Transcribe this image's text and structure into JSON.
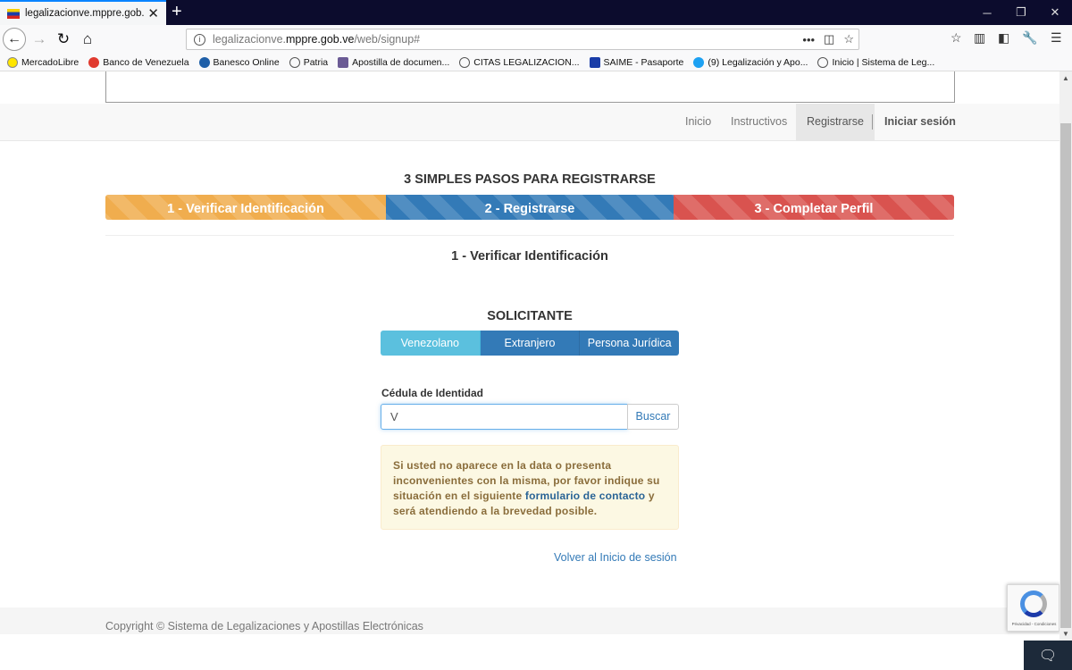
{
  "browser": {
    "tab_title": "legalizacionve.mppre.gob.ve/w",
    "new_tab_glyph": "+",
    "url_plain": "legalizacionve.",
    "url_domain": "mppre.gob.ve",
    "url_path": "/web/signup#",
    "bookmarks": [
      {
        "label": "MercadoLibre",
        "color": "#ffe600"
      },
      {
        "label": "Banco de Venezuela",
        "color": "#e03a2f"
      },
      {
        "label": "Banesco Online",
        "color": "#1f5fa8"
      },
      {
        "label": "Patria",
        "color": "#7a7a7a"
      },
      {
        "label": "Apostilla de documen...",
        "color": "#6b5b95"
      },
      {
        "label": "CITAS LEGALIZACION...",
        "color": "#7a7a7a"
      },
      {
        "label": "SAIME - Pasaporte",
        "color": "#1a3da8"
      },
      {
        "label": "(9) Legalización y Apo...",
        "color": "#1da1f2"
      },
      {
        "label": "Inicio | Sistema de Leg...",
        "color": "#7a7a7a"
      }
    ]
  },
  "nav": {
    "items": [
      {
        "label": "Inicio"
      },
      {
        "label": "Instructivos"
      },
      {
        "label": "Registrarse"
      },
      {
        "label": "Iniciar sesión"
      }
    ]
  },
  "steps": {
    "title": "3 SIMPLES PASOS PARA REGISTRARSE",
    "bars": [
      {
        "label": "1 - Verificar Identificación",
        "color": "#f0ad4e"
      },
      {
        "label": "2 - Registrarse",
        "color": "#337ab7"
      },
      {
        "label": "3 - Completar Perfil",
        "color": "#d9534f"
      }
    ],
    "current_heading": "1 - Verificar Identificación"
  },
  "form": {
    "solicitante_title": "SOLICITANTE",
    "types": [
      {
        "label": "Venezolano",
        "active": true
      },
      {
        "label": "Extranjero",
        "active": false
      },
      {
        "label": "Persona Jurídica",
        "active": false
      }
    ],
    "cedula_label": "Cédula de Identidad",
    "cedula_value": "V",
    "search_label": "Buscar",
    "alert_text_1": "Si usted no aparece en la data o presenta inconvenientes con la misma, por favor indique su situación en el siguiente",
    "alert_link": "formulario de contacto",
    "alert_text_2": "y será atendiendo a la brevedad posible.",
    "back_link": "Volver al Inicio de sesión"
  },
  "footer": {
    "copyright": "Copyright © Sistema de Legalizaciones y Apostillas Electrónicas"
  },
  "recaptcha": {
    "text": "Privacidad - Condiciones"
  },
  "colors": {
    "accent": "#337ab7",
    "info": "#5bc0de",
    "warning_bg": "#fcf8e3",
    "warning_text": "#8a6d3b"
  }
}
